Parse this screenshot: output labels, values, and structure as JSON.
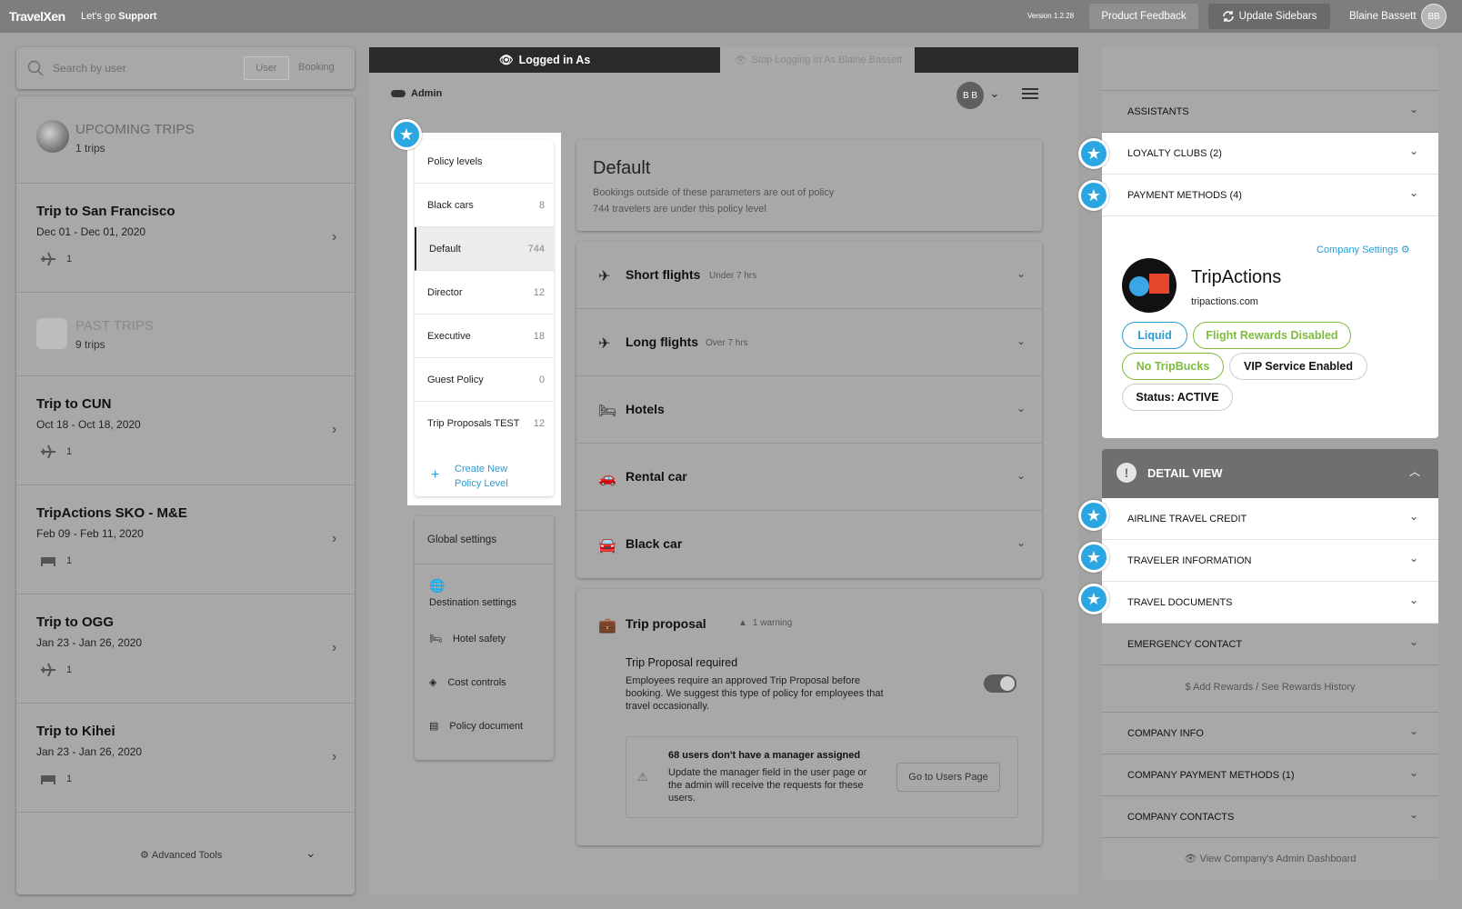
{
  "topbar": {
    "brand": "TravelXen",
    "tag_prefix": "Let's go",
    "tag_bold": "Support",
    "version": "Version 1.2.28",
    "feedback": "Product Feedback",
    "update": "Update Sidebars",
    "user": "Blaine Bassett",
    "avatar": "BB"
  },
  "search": {
    "placeholder": "Search by user",
    "seg_user": "User",
    "seg_booking": "Booking"
  },
  "upcoming": {
    "heading": "UPCOMING TRIPS",
    "count": "1 trips"
  },
  "past": {
    "heading": "PAST TRIPS",
    "count": "9 trips"
  },
  "trips": [
    {
      "title": "Trip to San Francisco",
      "dates": "Dec 01 - Dec 01, 2020",
      "icon": "plane-icon",
      "count": "1"
    },
    {
      "title": "Trip to CUN",
      "dates": "Oct 18 - Oct 18, 2020",
      "icon": "plane-icon",
      "count": "1"
    },
    {
      "title": "TripActions SKO - M&E",
      "dates": "Feb 09 - Feb 11, 2020",
      "icon": "bed-icon",
      "count": "1"
    },
    {
      "title": "Trip to OGG",
      "dates": "Jan 23 - Jan 26, 2020",
      "icon": "plane-icon",
      "count": "1"
    },
    {
      "title": "Trip to Kihei",
      "dates": "Jan 23 - Jan 26, 2020",
      "icon": "bed-icon",
      "count": "1"
    }
  ],
  "advanced": "Advanced Tools",
  "mid": {
    "logged_in": "Logged in As",
    "stop": "Stop Logging In As Blaine Bassett",
    "admin": "Admin",
    "avatar": "B B"
  },
  "policy_levels": {
    "header": "Policy levels",
    "items": [
      {
        "label": "Black cars",
        "count": "8"
      },
      {
        "label": "Default",
        "count": "744"
      },
      {
        "label": "Director",
        "count": "12"
      },
      {
        "label": "Executive",
        "count": "18"
      },
      {
        "label": "Guest Policy",
        "count": "0"
      },
      {
        "label": "Trip Proposals TEST",
        "count": "12"
      }
    ],
    "create_line1": "Create New",
    "create_line2": "Policy Level"
  },
  "global": {
    "header": "Global settings",
    "items": [
      "Destination settings",
      "Hotel safety",
      "Cost controls",
      "Policy document"
    ]
  },
  "default": {
    "title": "Default",
    "line1": "Bookings outside of these parameters are out of policy",
    "line2": "744 travelers are under this policy level"
  },
  "categories": [
    {
      "label": "Short flights",
      "sub": "Under 7 hrs"
    },
    {
      "label": "Long flights",
      "sub": "Over 7 hrs"
    },
    {
      "label": "Hotels",
      "sub": ""
    },
    {
      "label": "Rental car",
      "sub": ""
    },
    {
      "label": "Black car",
      "sub": ""
    }
  ],
  "trip_proposal": {
    "title": "Trip proposal",
    "warning": "1 warning",
    "required": "Trip Proposal required",
    "desc": "Employees require an approved Trip Proposal before booking. We suggest this type of policy for employees that travel occasionally.",
    "box_head": "68 users don't have a manager assigned",
    "box_body": "Update the manager field in the user page or the admin will receive the requests for these users.",
    "go": "Go to Users Page",
    "toggle_on": true
  },
  "right": {
    "assistants": "ASSISTANTS",
    "loyalty": "LOYALTY CLUBS (2)",
    "payment": "PAYMENT METHODS (4)",
    "company_settings": "Company Settings",
    "company_name": "TripActions",
    "company_domain": "tripactions.com",
    "pills": [
      "Liquid",
      "Flight Rewards Disabled",
      "No TripBucks",
      "VIP Service Enabled",
      "Status: ACTIVE"
    ],
    "detail_view": "DETAIL VIEW",
    "rows": [
      "AIRLINE TRAVEL CREDIT",
      "TRAVELER INFORMATION",
      "TRAVEL DOCUMENTS",
      "EMERGENCY CONTACT"
    ],
    "rewards": "Add Rewards / See Rewards History",
    "rows2": [
      "COMPANY INFO",
      "COMPANY PAYMENT METHODS (1)",
      "COMPANY CONTACTS"
    ],
    "dashboard": "View Company's Admin Dashboard"
  },
  "colors": {
    "accent": "#2ba6e0",
    "green": "#7dbb3c",
    "highlight": "#ffffff"
  }
}
